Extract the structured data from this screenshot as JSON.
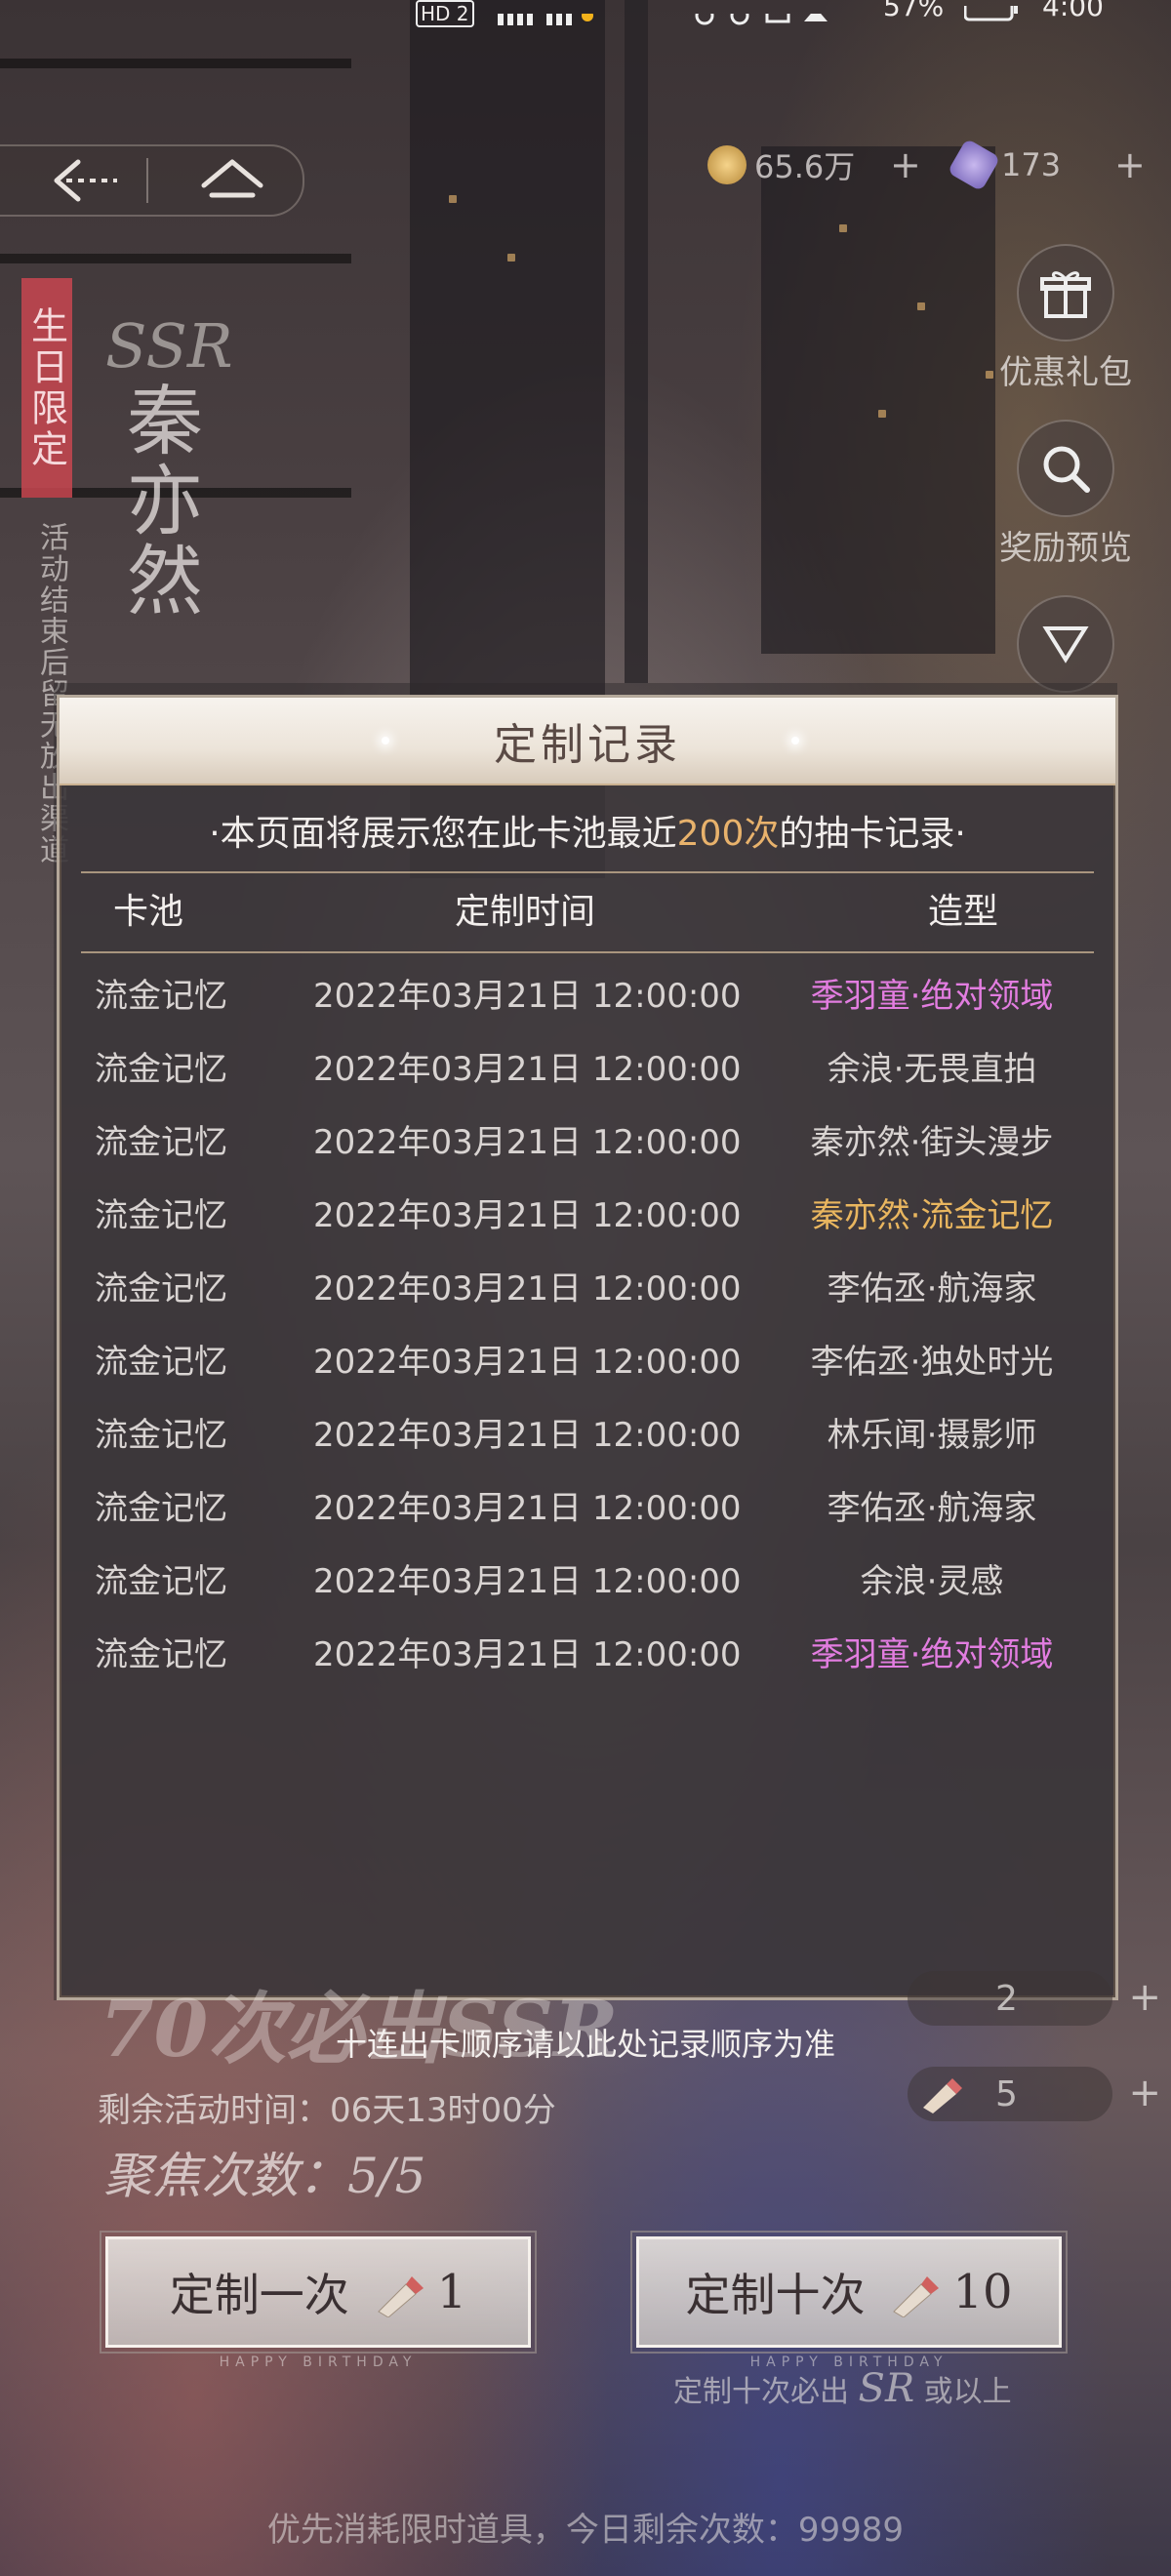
{
  "status_bar": {
    "hd_badge": "HD 2",
    "battery": "57%",
    "time": "4:00"
  },
  "nav": {
    "back_icon": "back-arrow-icon",
    "home_icon": "home-icon"
  },
  "currencies": [
    {
      "icon": "gold-coin-icon",
      "value": "65.6万",
      "plus": "+"
    },
    {
      "icon": "diamond-icon",
      "value": "173",
      "plus": "+"
    }
  ],
  "banner": {
    "ribbon": "生日限定",
    "vertical_note": "活动结束后留无放出渠道",
    "rank": "SSR",
    "character": "秦亦然"
  },
  "side_buttons": [
    {
      "icon": "gift-icon",
      "label": "优惠礼包"
    },
    {
      "icon": "magnifier-icon",
      "label": "奖励预览"
    }
  ],
  "modal": {
    "title": "定制记录",
    "intro_prefix": "·本页面将展示您在此卡池最近",
    "intro_highlight": "200次",
    "intro_suffix": "的抽卡记录·",
    "columns": {
      "pool": "卡池",
      "time": "定制时间",
      "style": "造型"
    },
    "rows": [
      {
        "pool": "流金记忆",
        "time": "2022年03月21日 12:00:00",
        "style": "季羽童·绝对领域",
        "tier": "purple"
      },
      {
        "pool": "流金记忆",
        "time": "2022年03月21日 12:00:00",
        "style": "余浪·无畏直拍",
        "tier": "normal"
      },
      {
        "pool": "流金记忆",
        "time": "2022年03月21日 12:00:00",
        "style": "秦亦然·街头漫步",
        "tier": "normal"
      },
      {
        "pool": "流金记忆",
        "time": "2022年03月21日 12:00:00",
        "style": "秦亦然·流金记忆",
        "tier": "gold"
      },
      {
        "pool": "流金记忆",
        "time": "2022年03月21日 12:00:00",
        "style": "李佑丞·航海家",
        "tier": "normal"
      },
      {
        "pool": "流金记忆",
        "time": "2022年03月21日 12:00:00",
        "style": "李佑丞·独处时光",
        "tier": "normal"
      },
      {
        "pool": "流金记忆",
        "time": "2022年03月21日 12:00:00",
        "style": "林乐闻·摄影师",
        "tier": "normal"
      },
      {
        "pool": "流金记忆",
        "time": "2022年03月21日 12:00:00",
        "style": "李佑丞·航海家",
        "tier": "normal"
      },
      {
        "pool": "流金记忆",
        "time": "2022年03月21日 12:00:00",
        "style": "余浪·灵感",
        "tier": "normal"
      },
      {
        "pool": "流金记忆",
        "time": "2022年03月21日 12:00:00",
        "style": "季羽童·绝对领域",
        "tier": "purple"
      }
    ]
  },
  "bottom": {
    "order_note": "十连出卡顺序请以此处记录顺序为准",
    "slogan": "70次必出SSR",
    "remain_time": "剩余活动时间：06天13时00分",
    "focus_count": "聚焦次数：5/5",
    "item_counts": [
      "2",
      "5"
    ],
    "draw_once": {
      "label": "定制一次",
      "count": "1"
    },
    "draw_ten": {
      "label": "定制十次",
      "count": "10"
    },
    "button_subtext": "HAPPY BIRTHDAY",
    "ten_note_prefix": "定制十次必出",
    "ten_note_sr": "SR",
    "ten_note_suffix": "或以上",
    "footer": "优先消耗限时道具，今日剩余次数：99989"
  },
  "colors": {
    "accent_gold": "#e9b65f",
    "accent_purple": "#e27de0",
    "highlight": "#e8b26c"
  }
}
